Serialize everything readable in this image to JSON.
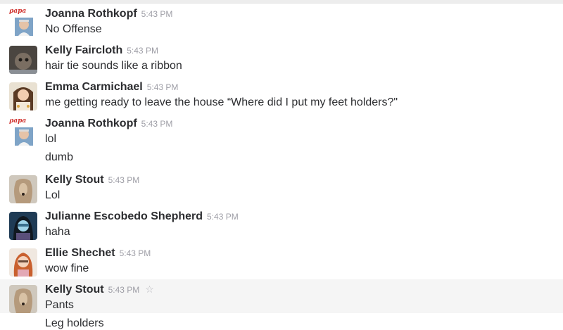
{
  "messages": [
    {
      "author": "Joanna Rothkopf",
      "time": "5:43 PM",
      "text": "No Offense",
      "avatar": "avatar-joanna-papa",
      "avatar_tag": "papa"
    },
    {
      "author": "Kelly Faircloth",
      "time": "5:43 PM",
      "text": "hair tie sounds like a ribbon",
      "avatar": "avatar-kelly-faircloth"
    },
    {
      "author": "Emma Carmichael",
      "time": "5:43 PM",
      "text": "me getting ready to leave the house “Where did I put my feet holders?\"",
      "avatar": "avatar-emma"
    },
    {
      "author": "Joanna Rothkopf",
      "time": "5:43 PM",
      "text": "lol",
      "avatar": "avatar-joanna-papa",
      "avatar_tag": "papa",
      "continuation": "dumb"
    },
    {
      "author": "Kelly Stout",
      "time": "5:43 PM",
      "text": "Lol",
      "avatar": "avatar-kelly-stout-dog"
    },
    {
      "author": "Julianne Escobedo Shepherd",
      "time": "5:43 PM",
      "text": "haha",
      "avatar": "avatar-julianne"
    },
    {
      "author": "Ellie Shechet",
      "time": "5:43 PM",
      "text": "wow fine",
      "avatar": "avatar-ellie"
    },
    {
      "author": "Kelly Stout",
      "time": "5:43 PM",
      "text": "Pants",
      "avatar": "avatar-kelly-stout-dog",
      "star_icon": "star-icon",
      "continuation": "Leg holders"
    }
  ],
  "colors": {
    "name": "#2c2d30",
    "time": "#9e9ea6",
    "hover_bg": "#f5f5f5",
    "star": "#b8b8bd"
  }
}
